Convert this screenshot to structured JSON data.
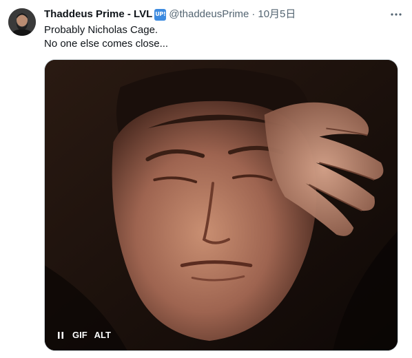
{
  "tweet": {
    "author": {
      "display_name": "Thaddeus Prime - LVL",
      "badge": "UP!",
      "handle": "@thaddeusPrime",
      "separator": "·",
      "date": "10月5日"
    },
    "text_lines": [
      "Probably Nicholas Cage.",
      "No one else comes close..."
    ],
    "media": {
      "type": "gif",
      "controls": {
        "gif_label": "GIF",
        "alt_label": "ALT"
      }
    }
  },
  "icons": {
    "more": "more-horizontal-icon",
    "pause": "pause-icon"
  },
  "colors": {
    "text_primary": "#0f1419",
    "text_secondary": "#536471",
    "badge_bg": "#3d8be0"
  }
}
